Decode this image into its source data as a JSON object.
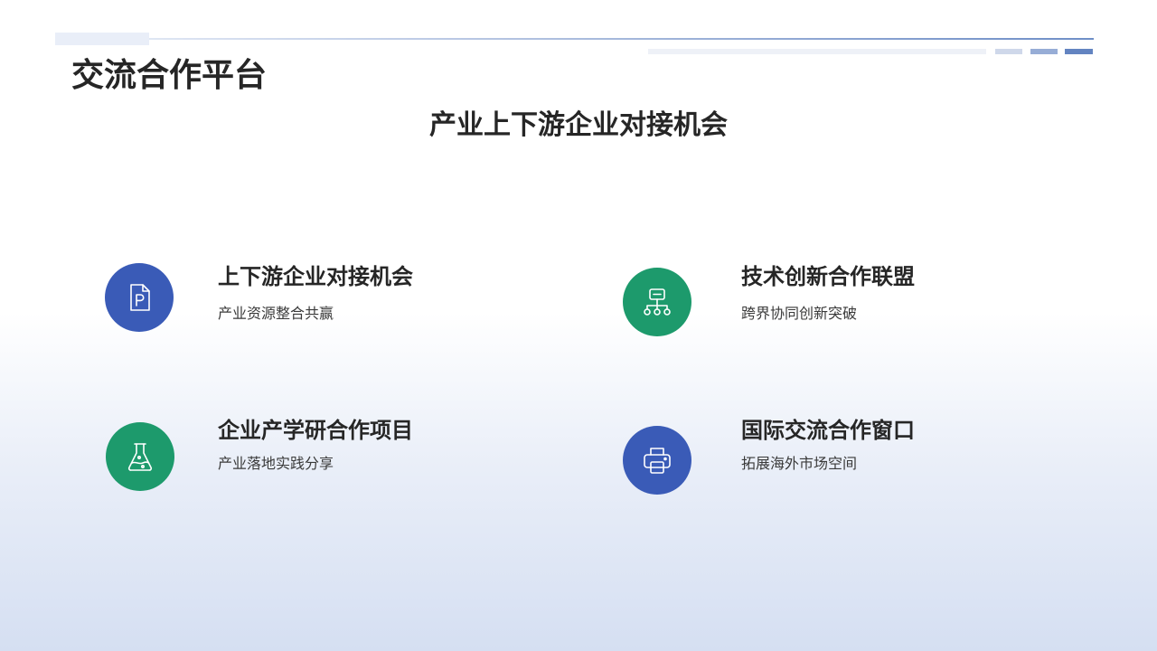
{
  "header": {
    "title": "交流合作平台"
  },
  "main": {
    "subtitle": "产业上下游企业对接机会",
    "items": [
      {
        "title": "上下游企业对接机会",
        "description": "产业资源整合共赢",
        "icon": "document-p-icon",
        "color": "#3a5bb7"
      },
      {
        "title": "技术创新合作联盟",
        "description": "跨界协同创新突破",
        "icon": "org-chart-icon",
        "color": "#1d9a6c"
      },
      {
        "title": "企业产学研合作项目",
        "description": "产业落地实践分享",
        "icon": "flask-icon",
        "color": "#1d9a6c"
      },
      {
        "title": "国际交流合作窗口",
        "description": "拓展海外市场空间",
        "icon": "printer-icon",
        "color": "#3a5bb7"
      }
    ]
  },
  "colors": {
    "accent_blue": "#3a5bb7",
    "accent_green": "#1d9a6c",
    "text_dark": "#262626"
  }
}
